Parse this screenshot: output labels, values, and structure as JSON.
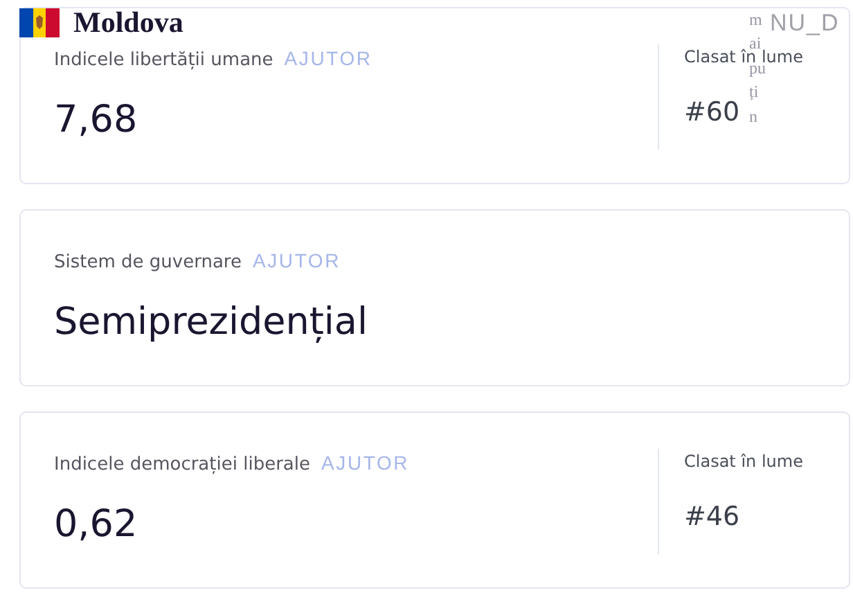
{
  "header": {
    "title": "Moldova"
  },
  "cards": [
    {
      "label": "Indicele libertății umane",
      "help": "AJUTOR",
      "value": "7,68",
      "rank_label": "Clasat în lume",
      "rank": "#60"
    },
    {
      "label": "Sistem de guvernare",
      "help": "AJUTOR",
      "value": "Semiprezidențial"
    },
    {
      "label": "Indicele democrației liberale",
      "help": "AJUTOR",
      "value": "0,62",
      "rank_label": "Clasat în lume",
      "rank": "#46"
    }
  ],
  "overlay": {
    "vertical_text": "mai puțin",
    "cut_text": "NU_D"
  }
}
